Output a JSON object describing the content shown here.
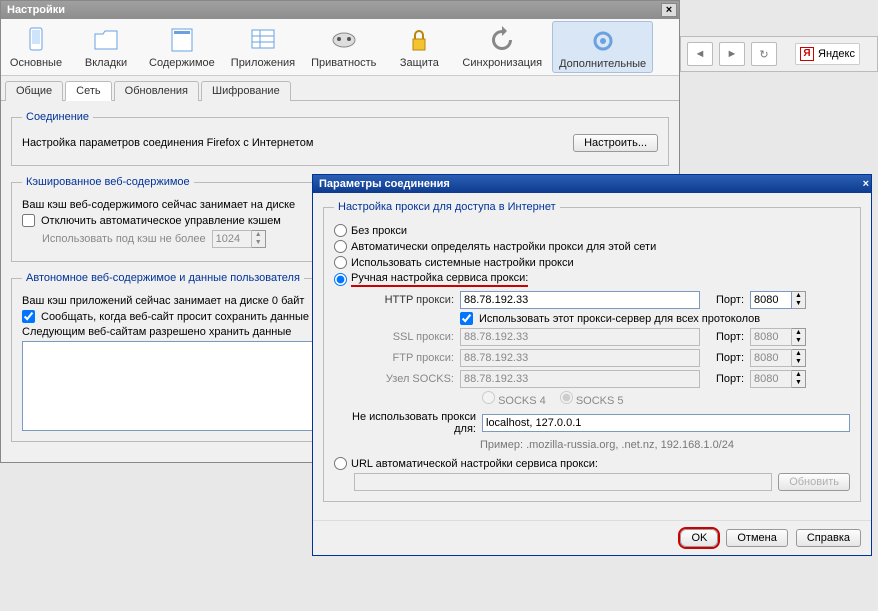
{
  "settings": {
    "title": "Настройки",
    "toolbar": [
      {
        "label": "Основные",
        "name": "tab-general"
      },
      {
        "label": "Вкладки",
        "name": "tab-tabs"
      },
      {
        "label": "Содержимое",
        "name": "tab-content"
      },
      {
        "label": "Приложения",
        "name": "tab-applications"
      },
      {
        "label": "Приватность",
        "name": "tab-privacy"
      },
      {
        "label": "Защита",
        "name": "tab-security"
      },
      {
        "label": "Синхронизация",
        "name": "tab-sync"
      },
      {
        "label": "Дополнительные",
        "name": "tab-advanced"
      }
    ],
    "subtabs": [
      {
        "label": "Общие"
      },
      {
        "label": "Сеть"
      },
      {
        "label": "Обновления"
      },
      {
        "label": "Шифрование"
      }
    ],
    "connection": {
      "legend": "Соединение",
      "desc": "Настройка параметров соединения Firefox с Интернетом",
      "configure_btn": "Настроить..."
    },
    "cache": {
      "legend": "Кэшированное веб-содержимое",
      "status_prefix": "Ваш кэш веб-содержимого сейчас занимает на диске",
      "override_label": "Отключить автоматическое управление кэшем",
      "limit_prefix": "Использовать под кэш не более",
      "limit_value": "1024"
    },
    "offline": {
      "legend": "Автономное веб-содержимое и данные пользователя",
      "status": "Ваш кэш приложений сейчас занимает на диске 0 байт",
      "notify_label": "Сообщать, когда веб-сайт просит сохранить данные",
      "list_label": "Следующим веб-сайтам разрешено хранить данные"
    }
  },
  "browser": {
    "search_label": "Яндекс"
  },
  "conn": {
    "title": "Параметры соединения",
    "group": "Настройка прокси для доступа в Интернет",
    "radios": {
      "none": "Без прокси",
      "auto": "Автоматически определять настройки прокси для этой сети",
      "system": "Использовать системные настройки прокси",
      "manual": "Ручная настройка сервиса прокси:",
      "url": "URL автоматической настройки сервиса прокси:"
    },
    "fields": {
      "http": "HTTP прокси:",
      "ssl": "SSL прокси:",
      "ftp": "FTP прокси:",
      "socks": "Узел SOCKS:",
      "port": "Порт:"
    },
    "use_for_all": "Использовать этот прокси-сервер для всех протоколов",
    "http_host": "88.78.192.33",
    "http_port": "8080",
    "ssl_host": "88.78.192.33",
    "ssl_port": "8080",
    "ftp_host": "88.78.192.33",
    "ftp_port": "8080",
    "socks_host": "88.78.192.33",
    "socks_port": "8080",
    "socks4": "SOCKS 4",
    "socks5": "SOCKS 5",
    "noproxy_label": "Не использовать прокси для:",
    "noproxy_value": "localhost, 127.0.0.1",
    "noproxy_example": "Пример: .mozilla-russia.org, .net.nz, 192.168.1.0/24",
    "url_value": "",
    "reload_btn": "Обновить",
    "ok": "OK",
    "cancel": "Отмена",
    "help": "Справка"
  }
}
